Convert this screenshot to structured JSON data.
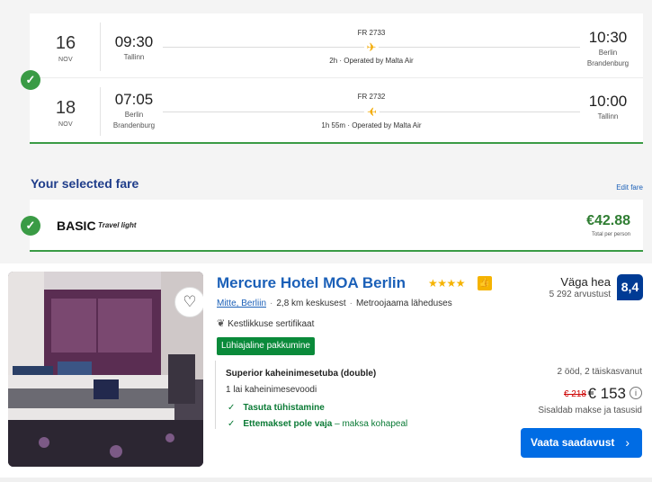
{
  "flights": [
    {
      "day": "16",
      "month": "NOV",
      "dep_time": "09:30",
      "dep_city": "Tallinn",
      "flight_no": "FR 2733",
      "duration": "2h · Operated by Malta Air",
      "arr_time": "10:30",
      "arr_city_1": "Berlin",
      "arr_city_2": "Brandenburg"
    },
    {
      "day": "18",
      "month": "NOV",
      "dep_time": "07:05",
      "dep_city_1": "Berlin",
      "dep_city_2": "Brandenburg",
      "flight_no": "FR 2732",
      "duration": "1h 55m · Operated by Malta Air",
      "arr_time": "10:00",
      "arr_city": "Tallinn"
    }
  ],
  "fare": {
    "title": "Your selected fare",
    "edit": "Edit fare",
    "name": "BASIC",
    "tag": "Travel light",
    "price": "€42.88",
    "price_note": "Total per person"
  },
  "hotel": {
    "name": "Mercure Hotel MOA Berlin",
    "stars": "★★★★",
    "location_link": "Mitte, Berliin",
    "distance": "2,8 km keskusest",
    "metro": "Metroojaama läheduses",
    "certificate": "Kestlikkuse sertifikaat",
    "badge": "Lühiajaline pakkumine",
    "room_name": "Superior kaheinimesetuba (double)",
    "bed": "1 lai kaheinimesevoodi",
    "perk1": "Tasuta tühistamine",
    "perk2_bold": "Ettemakset pole vaja",
    "perk2_rest": " – maksa kohapeal",
    "rating_word": "Väga hea",
    "reviews": "5 292 arvustust",
    "score": "8,4",
    "nights": "2 ööd, 2 täiskasvanut",
    "old_price": "€ 218",
    "new_price": "€ 153",
    "taxes": "Sisaldab makse ja tasusid",
    "cta": "Vaata saadavust"
  },
  "colors": {
    "accent": "#3a9b45",
    "brand_blue": "#006ce4",
    "title_blue": "#1f3d8a",
    "star": "#f5b300"
  },
  "icons": {
    "check": "check-icon",
    "plane": "airplane-icon",
    "heart": "heart-icon",
    "leaf": "leaf-icon",
    "info": "info-icon",
    "chevron": "chevron-right-icon"
  }
}
